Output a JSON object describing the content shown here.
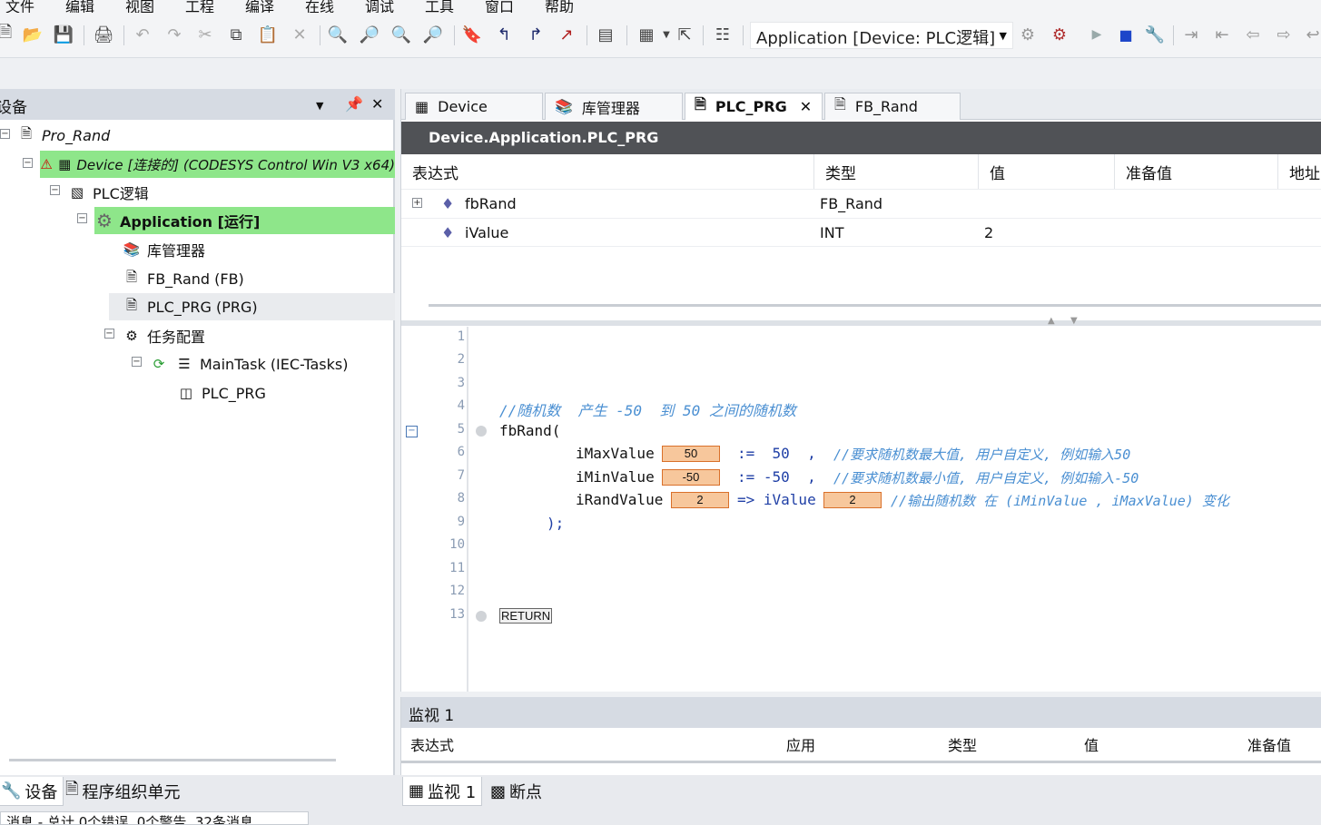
{
  "menu": [
    "文件",
    "编辑",
    "视图",
    "工程",
    "编译",
    "在线",
    "调试",
    "工具",
    "窗口",
    "帮助"
  ],
  "toolbar": {
    "app_selector": "Application [Device: PLC逻辑]"
  },
  "devices_pane": {
    "title": "设备",
    "tree": {
      "project": "Pro_Rand",
      "device": "Device [连接的] (CODESYS Control Win V3 x64)",
      "plc_logic": "PLC逻辑",
      "application": "Application [运行]",
      "library_manager": "库管理器",
      "fb_rand": "FB_Rand (FB)",
      "plc_prg": "PLC_PRG (PRG)",
      "task_config": "任务配置",
      "main_task": "MainTask (IEC-Tasks)",
      "task_prg": "PLC_PRG"
    }
  },
  "editor": {
    "tabs": [
      {
        "label": "Device"
      },
      {
        "label": "库管理器"
      },
      {
        "label": "PLC_PRG"
      },
      {
        "label": "FB_Rand"
      }
    ],
    "path": "Device.Application.PLC_PRG",
    "decl_headers": [
      "表达式",
      "类型",
      "值",
      "准备值",
      "地址"
    ],
    "decl_rows": [
      {
        "expr": "fbRand",
        "type": "FB_Rand",
        "value": ""
      },
      {
        "expr": "iValue",
        "type": "INT",
        "value": "2"
      }
    ],
    "line_numbers": [
      "1",
      "2",
      "3",
      "4",
      "5",
      "6",
      "7",
      "8",
      "9",
      "10",
      "11",
      "12",
      "13"
    ],
    "code": {
      "l4": "//随机数  产生 -50  到 50 之间的随机数",
      "l5": "fbRand(",
      "l6a": "iMaxValue",
      "l6b": ":=  50  ,",
      "l6c": "//要求随机数最大值, 用户自定义, 例如输入50",
      "l7a": "iMinValue",
      "l7b": ":= -50  ,",
      "l7c": "//要求随机数最小值, 用户自定义, 例如输入-50",
      "l8a": "iRandValue",
      "l8b": "=> iValue",
      "l8c": "//输出随机数 在 (iMinValue , iMaxValue) 变化",
      "l9": ");",
      "l13": "RETURN"
    },
    "monitor_values": {
      "max": "50",
      "min": "-50",
      "rand": "2",
      "ivalue": "2"
    }
  },
  "watch": {
    "title": "监视 1",
    "headers": [
      "表达式",
      "应用",
      "类型",
      "值",
      "准备值"
    ]
  },
  "bottom_tabs": {
    "devices": "设备",
    "pou": "程序组织单元",
    "watch": "监视 1",
    "breakpoints": "断点",
    "messages": "消息 - 总计 0个错误, 0个警告, 32条消息"
  }
}
